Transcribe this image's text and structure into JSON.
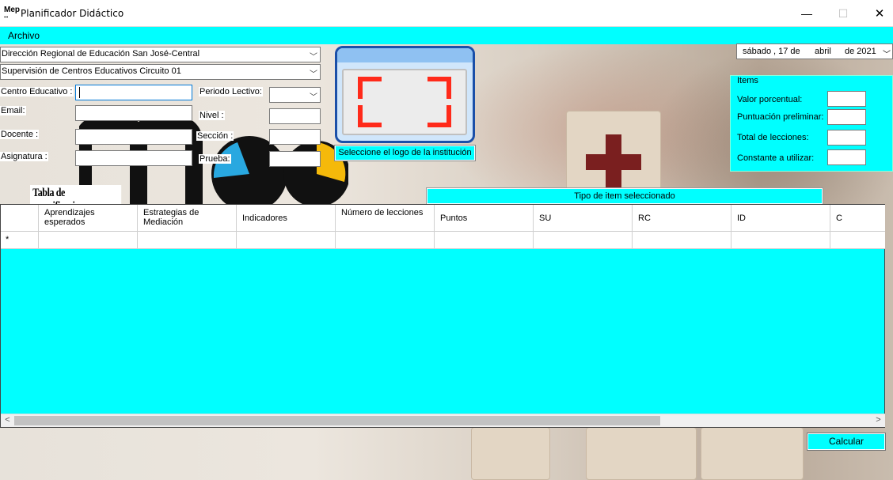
{
  "window": {
    "title": "Planificador Didáctico",
    "minimize": "—",
    "maximize": "☐",
    "close": "✕"
  },
  "menu": {
    "archivo": "Archivo"
  },
  "form": {
    "direccion": "Dirección Regional de Educación San José-Central",
    "supervision": "Supervisión de Centros Educativos Circuito 01",
    "centro_label": "Centro Educativo :",
    "email_label": "Email:",
    "docente_label": "Docente :",
    "asignatura_label": "Asignatura :",
    "periodo_label": "Periodo Lectivo:",
    "nivel_label": "Nivel :",
    "seccion_label": "Sección :",
    "prueba_label": "Prueba:"
  },
  "logo": {
    "button_label": "Seleccione el logo de la institución"
  },
  "date": {
    "weekday": "sábado",
    "day": ", 17 de",
    "month": "abril",
    "year": "de 2021"
  },
  "items": {
    "legend": "Items",
    "valor_label": "Valor porcentual:",
    "puntuacion_label": "Puntuación preliminar:",
    "total_label": "Total de lecciones:",
    "constante_label": "Constante a utilizar:"
  },
  "tabla_title": "Tabla de especificaciones",
  "tipo_button": "Tipo de item seleccionado",
  "grid": {
    "columns": [
      "Aprendizajes esperados",
      "Estrategias de Mediación",
      "Indicadores",
      "Número de lecciones",
      "Puntos",
      "SU",
      "RC",
      "ID",
      "C"
    ],
    "new_row_marker": "*"
  },
  "calcular": "Calcular",
  "colors": {
    "accent": "#00ffff",
    "logo_frame": "#1a4fa8",
    "logo_corners": "#ff2a1a"
  }
}
